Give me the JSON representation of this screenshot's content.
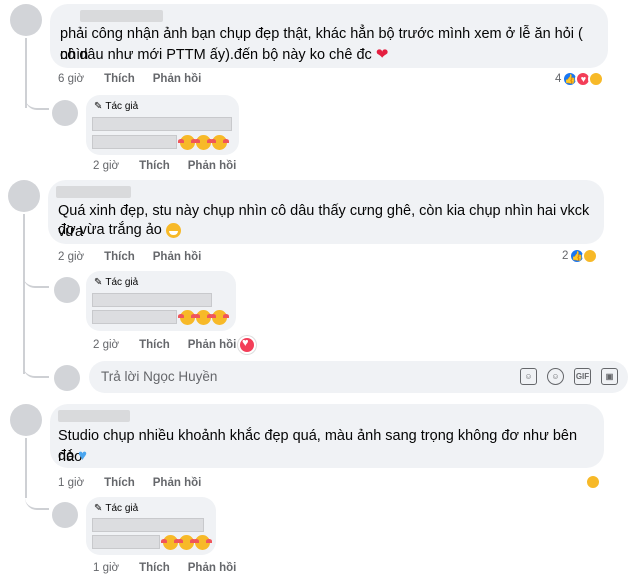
{
  "comments": [
    {
      "text": "phải công nhận ảnh bạn chụp đẹp thật, khác hẳn bộ trước mình xem ở lễ ăn hỏi ( nhìn cô dâu như mới PTTM ấy).đến bộ này ko chê đc ❤️",
      "line1": "phải công nhận ảnh bạn chụp đẹp thật, khác hẳn bộ trước mình xem ở lễ ăn hỏi ( nhìn",
      "line2": "cô dâu như mới PTTM ấy).đến bộ này ko chê đc",
      "time": "6 giờ",
      "like": "Thích",
      "reply": "Phản hồi",
      "reaction_count": "4",
      "reply_item": {
        "author_label": "Tác giả",
        "time": "2 giờ",
        "like": "Thích",
        "reply": "Phản hồi"
      }
    },
    {
      "line1": "Quá xinh đẹp, stu này chụp nhìn cô dâu thấy cưng ghê, còn kia chụp nhìn hai vkck vừa",
      "line2": "đơ vừa trắng ảo",
      "time": "2 giờ",
      "like": "Thích",
      "reply": "Phản hồi",
      "reaction_count": "2",
      "reply_item": {
        "author_label": "Tác giả",
        "time": "2 giờ",
        "like": "Thích",
        "reply": "Phản hồi"
      }
    },
    {
      "line1": "Studio chụp nhiều khoảnh khắc đẹp quá, màu ảnh sang trọng không đơ như bên nào",
      "line2": "đó",
      "time": "1 giờ",
      "like": "Thích",
      "reply": "Phản hồi",
      "reply_item": {
        "author_label": "Tác giả",
        "time": "1 giờ",
        "like": "Thích",
        "reply": "Phản hồi"
      }
    }
  ],
  "reply_box": {
    "placeholder": "Trả lời Ngọc Huyền",
    "icons": [
      "sticker-icon",
      "emoji-icon",
      "gif-icon",
      "image-sticker-icon"
    ]
  },
  "colors": {
    "bubble": "#f0f2f5",
    "meta_text": "#65676b",
    "like_blue": "#1877f2",
    "love_red": "#f33e58"
  }
}
